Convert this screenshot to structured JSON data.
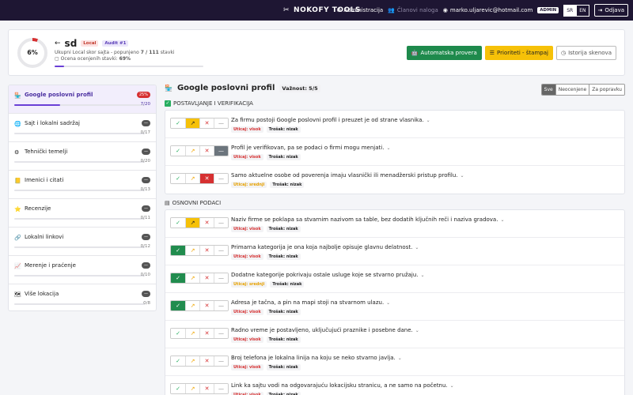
{
  "nav": {
    "brand": "NOKOFY TOOLS",
    "admin_link": "Administracija",
    "members_link": "Članovi naloga",
    "email": "marko.uljarevic@hotmail.com",
    "role_badge": "ADMIN",
    "lang_sr": "SR",
    "lang_en": "EN",
    "logout": "Odjava"
  },
  "header": {
    "score": "6%",
    "score_fraction": 0.06,
    "back": "←",
    "site_name": "sd",
    "badge_local": "Local",
    "badge_audit": "Audit #1",
    "line1_prefix": "Ukupni Local skor sajta - popunjeno",
    "line1_count": "7 / 111",
    "line1_suffix": "stavki",
    "line2_prefix": "Ocena ocenjenih stavki:",
    "line2_value": "69%",
    "progress": 0.063,
    "btn_auto": "Automatska provera",
    "btn_priorities": "Prioriteti - štampaj",
    "btn_history": "Istorija skenova"
  },
  "sidebar": {
    "items": [
      {
        "icon": "🏪",
        "label": "Google poslovni profil",
        "pill": "25%",
        "count": "7/20",
        "progress": 0.35,
        "active": true
      },
      {
        "icon": "🌐",
        "label": "Sajt i lokalni sadržaj",
        "pill": "—",
        "count": "0/17",
        "progress": 0
      },
      {
        "icon": "⚙",
        "label": "Tehnički temelji",
        "pill": "—",
        "count": "0/20",
        "progress": 0
      },
      {
        "icon": "📒",
        "label": "Imenici i citati",
        "pill": "—",
        "count": "0/13",
        "progress": 0
      },
      {
        "icon": "⭐",
        "label": "Recenzije",
        "pill": "—",
        "count": "0/11",
        "progress": 0
      },
      {
        "icon": "🔗",
        "label": "Lokalni linkovi",
        "pill": "—",
        "count": "0/12",
        "progress": 0
      },
      {
        "icon": "📈",
        "label": "Merenje i praćenje",
        "pill": "—",
        "count": "0/10",
        "progress": 0
      },
      {
        "icon": "🗺",
        "label": "Više lokacija",
        "pill": "—",
        "count": "0/8",
        "progress": 0
      }
    ]
  },
  "main": {
    "icon": "🏪",
    "title": "Google poslovni profil",
    "importance": "Važnost: 5/5",
    "filters": [
      "Sve",
      "Neocenjene",
      "Za popravku"
    ],
    "sections": [
      {
        "title": "POSTAVLJANJE I VERIFIKACIJA",
        "items": [
          {
            "text": "Za firmu postoji Google poslovni profil i preuzet je od strane vlasnika.",
            "state": "partial",
            "impact": "Uticaj: visok",
            "impact_level": "red",
            "cost": "Trošak: nizak"
          },
          {
            "text": "Profil je verifikovan, pa se podaci o firmi mogu menjati.",
            "state": "na",
            "impact": "Uticaj: visok",
            "impact_level": "red",
            "cost": "Trošak: nizak"
          },
          {
            "text": "Samo aktuelne osobe od poverenja imaju vlasnički ili menadžerski pristup profilu.",
            "state": "fail",
            "impact": "Uticaj: srednji",
            "impact_level": "yel",
            "cost": "Trošak: nizak"
          }
        ]
      },
      {
        "title": "OSNOVNI PODACI",
        "items": [
          {
            "text": "Naziv firme se poklapa sa stvarnim nazivom sa table, bez dodatih ključnih reči i naziva gradova.",
            "state": "partial",
            "impact": "Uticaj: visok",
            "impact_level": "red",
            "cost": "Trošak: nizak"
          },
          {
            "text": "Primarna kategorija je ona koja najbolje opisuje glavnu delatnost.",
            "state": "pass",
            "impact": "Uticaj: visok",
            "impact_level": "red",
            "cost": "Trošak: nizak"
          },
          {
            "text": "Dodatne kategorije pokrivaju ostale usluge koje se stvarno pružaju.",
            "state": "pass",
            "impact": "Uticaj: srednji",
            "impact_level": "yel",
            "cost": "Trošak: nizak"
          },
          {
            "text": "Adresa je tačna, a pin na mapi stoji na stvarnom ulazu.",
            "state": "pass",
            "impact": "Uticaj: visok",
            "impact_level": "red",
            "cost": "Trošak: nizak"
          },
          {
            "text": "Radno vreme je postavljeno, uključujući praznike i posebne dane.",
            "state": "none",
            "impact": "Uticaj: visok",
            "impact_level": "red",
            "cost": "Trošak: nizak"
          },
          {
            "text": "Broj telefona je lokalna linija na koju se neko stvarno javlja.",
            "state": "none",
            "impact": "Uticaj: visok",
            "impact_level": "red",
            "cost": "Trošak: nizak"
          },
          {
            "text": "Link ka sajtu vodi na odgovarajuću lokacijsku stranicu, a ne samo na početnu.",
            "state": "none",
            "impact": "Uticaj: visok",
            "impact_level": "red",
            "cost": "Trošak: nizak"
          }
        ]
      }
    ]
  },
  "symbols": {
    "pass": "✓",
    "partial": "↗",
    "fail": "✕",
    "na": "—",
    "chev": "⌄"
  },
  "colors": {
    "nav": "#1e1633",
    "accent": "#6a3fd6",
    "green": "#218c4e",
    "yellow": "#f6c108",
    "red": "#d63031"
  }
}
